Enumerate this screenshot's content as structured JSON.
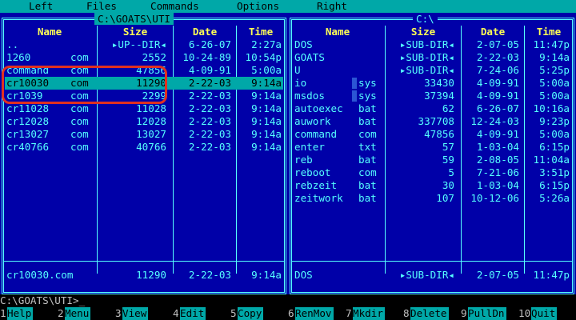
{
  "menu": [
    "Left",
    "Files",
    "Commands",
    "Options",
    "Right"
  ],
  "left_panel": {
    "path": "C:\\GOATS\\UTI",
    "headers": {
      "name": "Name",
      "size": "Size",
      "date": "Date",
      "time": "Time"
    },
    "rows": [
      {
        "name": "..",
        "ext": "",
        "size": "▸UP--DIR◂",
        "date": "6-26-07",
        "time": "2:27a"
      },
      {
        "name": "1260",
        "ext": "com",
        "size": "2552",
        "date": "10-24-89",
        "time": "10:54p"
      },
      {
        "name": "command",
        "ext": "com",
        "size": "47856",
        "date": "4-09-91",
        "time": "5:00a"
      },
      {
        "name": "cr10030",
        "ext": "com",
        "size": "11290",
        "date": "2-22-03",
        "time": "9:14a",
        "selected": true
      },
      {
        "name": "cr1039",
        "ext": "com",
        "size": "2299",
        "date": "2-22-03",
        "time": "9:14a"
      },
      {
        "name": "cr11028",
        "ext": "com",
        "size": "11028",
        "date": "2-22-03",
        "time": "9:14a"
      },
      {
        "name": "cr12028",
        "ext": "com",
        "size": "12028",
        "date": "2-22-03",
        "time": "9:14a"
      },
      {
        "name": "cr13027",
        "ext": "com",
        "size": "13027",
        "date": "2-22-03",
        "time": "9:14a"
      },
      {
        "name": "cr40766",
        "ext": "com",
        "size": "40766",
        "date": "2-22-03",
        "time": "9:14a"
      }
    ],
    "status": {
      "name": "cr10030.com",
      "size": "11290",
      "date": "2-22-03",
      "time": "9:14a"
    }
  },
  "right_panel": {
    "path": "C:\\",
    "headers": {
      "name": "Name",
      "size": "Size",
      "date": "Date",
      "time": "Time"
    },
    "rows": [
      {
        "name": "DOS",
        "ext": "",
        "size": "▸SUB-DIR◂",
        "date": "2-07-05",
        "time": "11:47p"
      },
      {
        "name": "GOATS",
        "ext": "",
        "size": "▸SUB-DIR◂",
        "date": "2-22-03",
        "time": "9:14a"
      },
      {
        "name": "U",
        "ext": "",
        "size": "▸SUB-DIR◂",
        "date": "7-24-06",
        "time": "5:25p"
      },
      {
        "name": "io",
        "ext": "sys",
        "size": "33430",
        "date": "4-09-91",
        "time": "5:00a",
        "hidden": true
      },
      {
        "name": "msdos",
        "ext": "sys",
        "size": "37394",
        "date": "4-09-91",
        "time": "5:00a",
        "hidden": true
      },
      {
        "name": "autoexec",
        "ext": "bat",
        "size": "62",
        "date": "6-26-07",
        "time": "10:16a"
      },
      {
        "name": "auwork",
        "ext": "bat",
        "size": "337708",
        "date": "12-24-03",
        "time": "9:23p"
      },
      {
        "name": "command",
        "ext": "com",
        "size": "47856",
        "date": "4-09-91",
        "time": "5:00a"
      },
      {
        "name": "enter",
        "ext": "txt",
        "size": "57",
        "date": "1-03-04",
        "time": "6:15p"
      },
      {
        "name": "reb",
        "ext": "bat",
        "size": "59",
        "date": "2-08-05",
        "time": "11:04a"
      },
      {
        "name": "reboot",
        "ext": "com",
        "size": "5",
        "date": "7-21-06",
        "time": "3:51p"
      },
      {
        "name": "rebzeit",
        "ext": "bat",
        "size": "30",
        "date": "1-03-04",
        "time": "6:15p"
      },
      {
        "name": "zeitwork",
        "ext": "bat",
        "size": "107",
        "date": "10-12-06",
        "time": "5:26a"
      }
    ],
    "status": {
      "name": "DOS",
      "size": "▸SUB-DIR◂",
      "date": "2-07-05",
      "time": "11:47p"
    }
  },
  "command_line": "C:\\GOATS\\UTI>_",
  "fkeys": [
    {
      "num": "1",
      "label": "Help"
    },
    {
      "num": "2",
      "label": "Menu"
    },
    {
      "num": "3",
      "label": "View"
    },
    {
      "num": "4",
      "label": "Edit"
    },
    {
      "num": "5",
      "label": "Copy"
    },
    {
      "num": "6",
      "label": "RenMov"
    },
    {
      "num": "7",
      "label": "Mkdir"
    },
    {
      "num": "8",
      "label": "Delete"
    },
    {
      "num": "9",
      "label": "PullDn"
    },
    {
      "num": "10",
      "label": "Quit"
    }
  ]
}
